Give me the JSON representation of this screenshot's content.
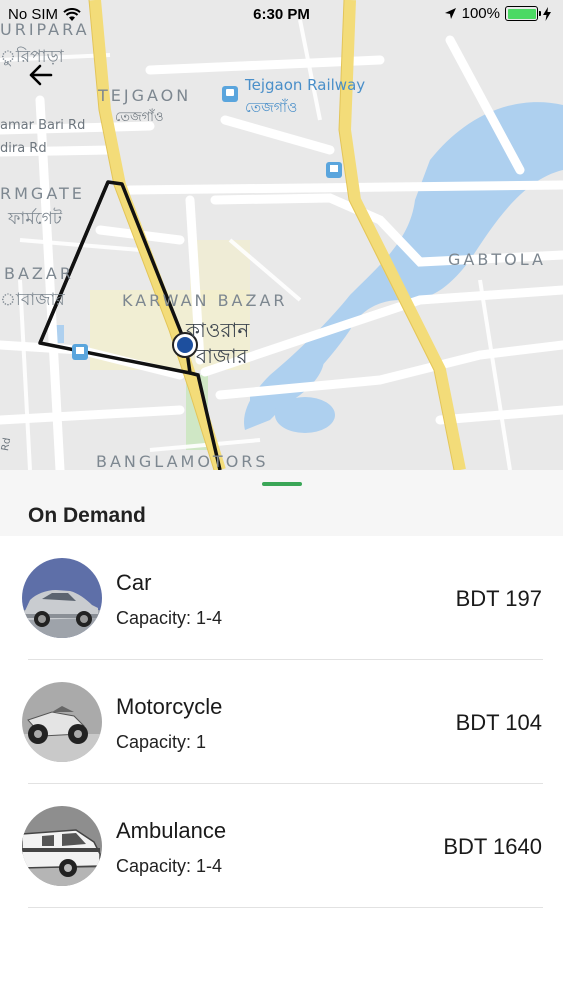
{
  "status_bar": {
    "carrier": "No SIM",
    "time": "6:30 PM",
    "battery": "100%",
    "battery_level": 1.0
  },
  "map": {
    "labels": {
      "uripara": "URIPARA",
      "uripara_bn": "ুরিপাড়া",
      "tejgaon": "TEJGAON",
      "tejgaon_bn": "তেজগাঁও",
      "tejgaon_railway": "Tejgaon Railway",
      "tejgaon_railway_bn": "তেজগাঁও",
      "amar_bari_rd": "amar Bari Rd",
      "dira_rd": "dira Rd",
      "farmgate": "RMGATE",
      "farmgate_bn": "ফার্মগেট",
      "bazar": "BAZAR",
      "bazar_bn": "াবাজার",
      "karwan_bazar": "KARWAN BAZAR",
      "karwan_bn_1": "কাওরান",
      "karwan_bn_2": "বাজার",
      "gabtola": "GABTOLA",
      "banglamotors": "BANGLAMOTORS",
      "rd_edge": "Rd"
    },
    "icons": [
      "train-station-icon",
      "bus-stop-icon",
      "current-location-icon"
    ]
  },
  "sheet": {
    "title": "On Demand",
    "accent_color": "#3aa657"
  },
  "vehicles": [
    {
      "name": "Car",
      "capacity": "Capacity: 1-4",
      "price": "BDT 197",
      "icon": "car-icon"
    },
    {
      "name": "Motorcycle",
      "capacity": "Capacity: 1",
      "price": "BDT 104",
      "icon": "motorcycle-icon"
    },
    {
      "name": "Ambulance",
      "capacity": "Capacity: 1-4",
      "price": "BDT 1640",
      "icon": "ambulance-icon"
    }
  ]
}
